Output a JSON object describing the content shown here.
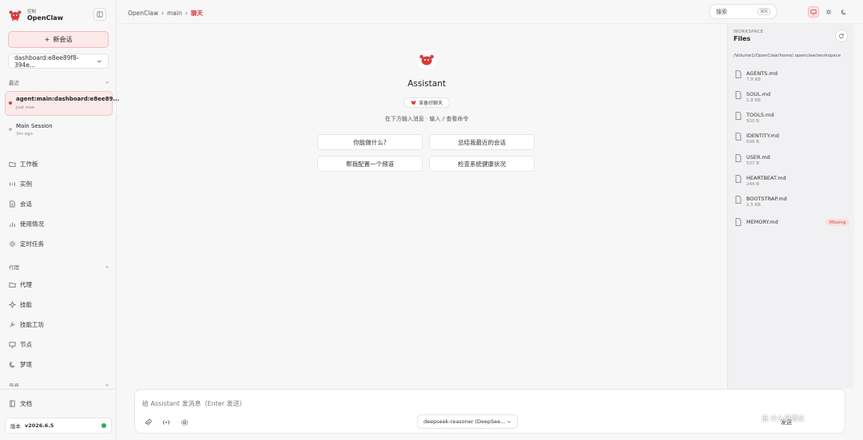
{
  "app": {
    "brand_small": "控制",
    "brand_name": "OpenClaw",
    "accent": "#d63a3a"
  },
  "sidebar": {
    "new_chat_label": "新会话",
    "session_select": "dashboard:e8ee89f8-394e...",
    "recent_label": "最近",
    "sessions": [
      {
        "title": "agent:main:dashboard:e8ee89...",
        "time": "just now"
      },
      {
        "title": "Main Session",
        "time": "3m ago"
      }
    ],
    "control_items": [
      {
        "label": "工作板",
        "icon": "folder-icon"
      },
      {
        "label": "实例",
        "icon": "broadcast-icon"
      },
      {
        "label": "会话",
        "icon": "document-icon"
      },
      {
        "label": "使用情况",
        "icon": "bar-chart-icon"
      },
      {
        "label": "定时任务",
        "icon": "gear-icon"
      }
    ],
    "agent_label": "代理",
    "agent_items": [
      {
        "label": "代理",
        "icon": "folder-icon"
      },
      {
        "label": "技能",
        "icon": "sparkle-icon"
      },
      {
        "label": "技能工坊",
        "icon": "wrench-icon"
      },
      {
        "label": "节点",
        "icon": "monitor-icon"
      },
      {
        "label": "梦境",
        "icon": "moon-icon"
      }
    ],
    "settings_label": "设置",
    "docs_label": "文档",
    "version_label": "版本",
    "version_value": "v2026.6.5"
  },
  "topbar": {
    "breadcrumb": [
      "OpenClaw",
      "main",
      "聊天"
    ],
    "search_placeholder": "搜索",
    "search_shortcut": "⌘K"
  },
  "chat": {
    "assistant_name": "Assistant",
    "status_badge": "准备好聊天",
    "hint": "在下方输入消息 · 输入 / 查看命令",
    "suggestions": [
      "你能做什么?",
      "总结我最近的会话",
      "帮我配置一个频道",
      "检查系统健康状况"
    ]
  },
  "composer": {
    "placeholder": "给 Assistant 发消息（Enter 发送）",
    "model": "deepseek-reasoner (DeepSee...",
    "send_label": "发送"
  },
  "workspace": {
    "label": "WORKSPACE",
    "title": "Files",
    "path": "/Volume1/OpenClaw/home/.openclaw/workspace",
    "files": [
      {
        "name": "AGENTS.md",
        "size": "7.9 KB"
      },
      {
        "name": "SOUL.md",
        "size": "1.8 KB"
      },
      {
        "name": "TOOLS.md",
        "size": "920 B"
      },
      {
        "name": "IDENTITY.md",
        "size": "696 B"
      },
      {
        "name": "USER.md",
        "size": "537 B"
      },
      {
        "name": "HEARTBEAT.md",
        "size": "244 B"
      },
      {
        "name": "BOOTSTRAP.md",
        "size": "1.5 KB"
      },
      {
        "name": "MEMORY.md",
        "size": ""
      }
    ],
    "missing_badge": "Missing"
  },
  "watermark": "值 什么值得买"
}
